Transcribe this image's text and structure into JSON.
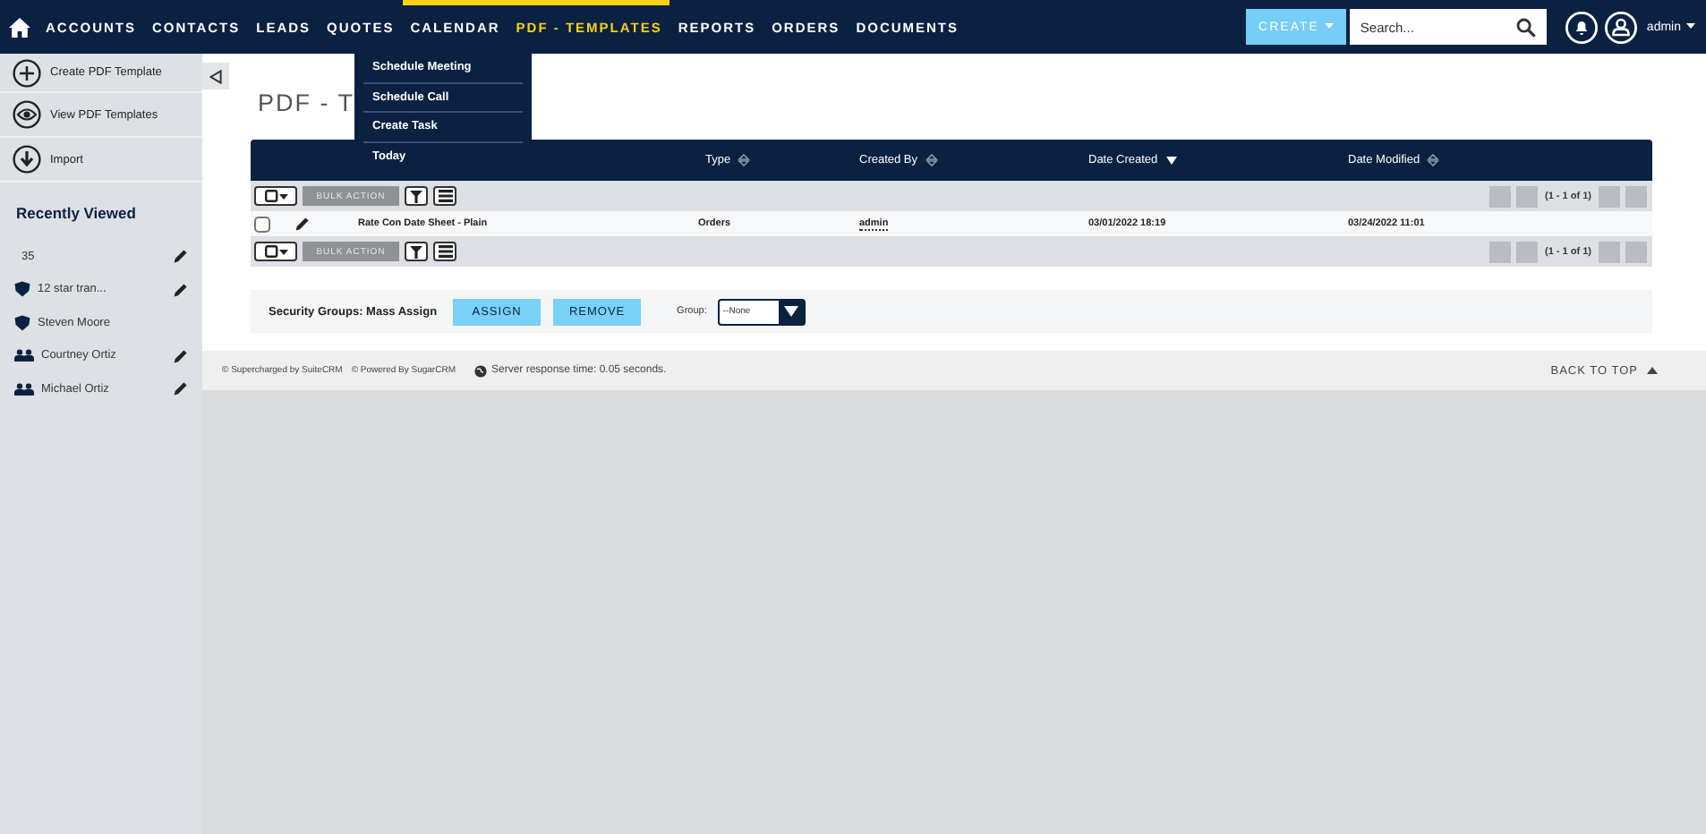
{
  "nav": {
    "items": [
      {
        "label": "ACCOUNTS",
        "selected": false,
        "hovered": false
      },
      {
        "label": "CONTACTS",
        "selected": false,
        "hovered": false
      },
      {
        "label": "LEADS",
        "selected": false,
        "hovered": false
      },
      {
        "label": "QUOTES",
        "selected": false,
        "hovered": false
      },
      {
        "label": "CALENDAR",
        "selected": false,
        "hovered": true
      },
      {
        "label": "PDF - TEMPLATES",
        "selected": true,
        "hovered": true
      },
      {
        "label": "REPORTS",
        "selected": false,
        "hovered": false
      },
      {
        "label": "ORDERS",
        "selected": false,
        "hovered": false
      },
      {
        "label": "DOCUMENTS",
        "selected": false,
        "hovered": false
      }
    ],
    "create_button": "CREATE",
    "search": {
      "placeholder": "Search..."
    },
    "user": "admin"
  },
  "calendar_menu": [
    "Schedule Meeting",
    "Schedule Call",
    "Create Task",
    "Today"
  ],
  "sidebar": {
    "actions": [
      {
        "label": "Create PDF Template",
        "kind": "plus"
      },
      {
        "label": "View PDF Templates",
        "kind": "eye"
      },
      {
        "label": "Import",
        "kind": "import"
      }
    ],
    "recent_title": "Recently Viewed",
    "recent": [
      {
        "label": "35",
        "kind": "none",
        "editable": true
      },
      {
        "label": "12 star tran...",
        "kind": "account",
        "editable": true
      },
      {
        "label": "Steven Moore",
        "kind": "account",
        "editable": false
      },
      {
        "label": "Courtney Ortiz",
        "kind": "contact",
        "editable": true
      },
      {
        "label": "Michael Ortiz",
        "kind": "contact",
        "editable": true
      }
    ]
  },
  "page_title": "PDF - T",
  "table": {
    "columns": [
      {
        "label": "Type",
        "sorted_desc": false
      },
      {
        "label": "Created By",
        "sorted_desc": false
      },
      {
        "label": "Date Created",
        "sorted_desc": true
      },
      {
        "label": "Date Modified",
        "sorted_desc": false
      }
    ],
    "action_bars": [
      {
        "bulk_action": "BULK ACTION",
        "pagination": "(1 - 1 of 1)"
      },
      {
        "bulk_action": "BULK ACTION",
        "pagination": "(1 - 1 of 1)"
      }
    ],
    "rows": [
      {
        "name": "Rate Con Date Sheet - Plain",
        "type": "Orders",
        "created_by": "admin",
        "date_created": "03/01/2022 18:19",
        "date_modified": "03/24/2022 11:01",
        "checked": false
      }
    ]
  },
  "mass_assign": {
    "label": "Security Groups: Mass Assign",
    "buttons": [
      "ASSIGN",
      "REMOVE"
    ],
    "group_label": "Group:",
    "group_value": "--None"
  },
  "footer": {
    "credits": [
      "© Supercharged by SuiteCRM",
      "© Powered By SugarCRM"
    ],
    "response": "Server response time: 0.05 seconds.",
    "back_to_top": "BACK TO TOP"
  }
}
